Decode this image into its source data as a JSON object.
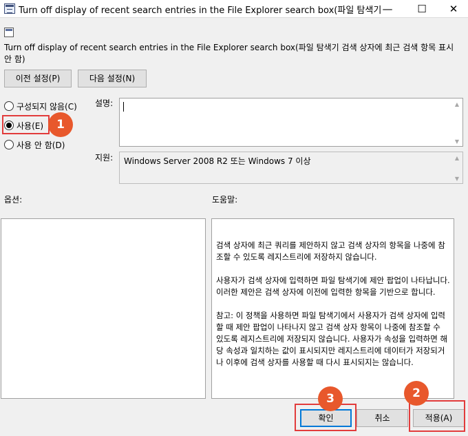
{
  "window": {
    "title": "Turn off display of recent search entries in the File Explorer search box(파일 탐색기 검색 상자...",
    "minimize_glyph": "—",
    "maximize_glyph": "☐",
    "close_glyph": "✕"
  },
  "policy": {
    "title": "Turn off display of recent search entries in the File Explorer search box(파일 탐색기 검색 상자에 최근 검색 항목 표시 안 함)"
  },
  "nav": {
    "prev_label": "이전 설정(P)",
    "next_label": "다음 설정(N)"
  },
  "state": {
    "options": [
      {
        "label": "구성되지 않음(C)",
        "selected": false
      },
      {
        "label": "사용(E)",
        "selected": true
      },
      {
        "label": "사용 안 함(D)",
        "selected": false
      }
    ]
  },
  "comment": {
    "label": "설명:",
    "value": ""
  },
  "supported": {
    "label": "지원:",
    "value": "Windows Server 2008 R2 또는 Windows 7 이상"
  },
  "options_label": "옵션:",
  "help": {
    "label": "도움말:",
    "paragraphs": [
      "검색 상자에 최근 쿼리를 제안하지 않고 검색 상자의 항목을 나중에 참조할 수 있도록 레지스트리에 저장하지 않습니다.",
      "사용자가 검색 상자에 입력하면 파일 탐색기에 제안 팝업이 나타납니다. 이러한 제안은 검색 상자에 이전에 입력한 항목을 기반으로 합니다.",
      "참고: 이 정책을 사용하면 파일 탐색기에서 사용자가 검색 상자에 입력할 때 제안 팝업이 나타나지 않고 검색 상자 항목이 나중에 참조할 수 있도록 레지스트리에 저장되지 않습니다. 사용자가 속성을 입력하면 해당 속성과 일치하는 값이 표시되지만 레지스트리에 데이터가 저장되거나 이후에 검색 상자를 사용할 때 다시 표시되지는 않습니다."
    ]
  },
  "footer": {
    "ok_label": "확인",
    "cancel_label": "취소",
    "apply_label": "적용(A)"
  },
  "annotations": {
    "step1": "1",
    "step2": "2",
    "step3": "3",
    "highlight_color": "#e23b3b",
    "badge_color": "#e8582c"
  }
}
